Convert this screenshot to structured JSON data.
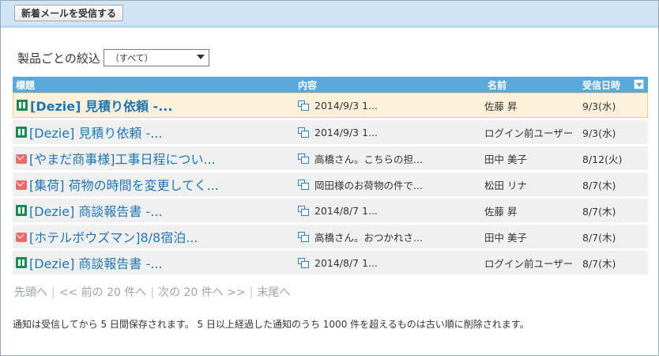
{
  "toolbar": {
    "fetch_label": "新着メールを受信する"
  },
  "filter": {
    "label": "製品ごとの絞込",
    "selected": "（すべて）"
  },
  "table": {
    "headers": {
      "subject": "標題",
      "content": "内容",
      "sender": "名前",
      "date": "受信日時"
    },
    "rows": [
      {
        "icon": "dezie-icon",
        "subject": "[Dezie] 見積り依頼 -...",
        "content": "2014/9/3 1...",
        "sender": "佐藤 昇",
        "date": "9/3(水)",
        "unread": true
      },
      {
        "icon": "dezie-icon",
        "subject": "[Dezie] 見積り依頼 -...",
        "content": "2014/9/3 1...",
        "sender": "ログイン前ユーザー",
        "date": "9/3(水)",
        "unread": false
      },
      {
        "icon": "mail-icon",
        "subject": "[やまだ商事様]工事日程につい...",
        "content": "高橋さん。こちらの担...",
        "sender": "田中 美子",
        "date": "8/12(火)",
        "unread": false
      },
      {
        "icon": "mail-icon",
        "subject": "[集荷] 荷物の時間を変更してく...",
        "content": "岡田様のお荷物の件で...",
        "sender": "松田 リナ",
        "date": "8/7(木)",
        "unread": false
      },
      {
        "icon": "dezie-icon",
        "subject": "[Dezie] 商談報告書 -...",
        "content": "2014/8/7 1...",
        "sender": "佐藤 昇",
        "date": "8/7(木)",
        "unread": false
      },
      {
        "icon": "mail-icon",
        "subject": "[ホテルボウズマン]8/8宿泊...",
        "content": "高橋さん。おつかれさ...",
        "sender": "田中 美子",
        "date": "8/7(木)",
        "unread": false
      },
      {
        "icon": "dezie-icon",
        "subject": "[Dezie] 商談報告書 -...",
        "content": "2014/8/7 1...",
        "sender": "ログイン前ユーザー",
        "date": "8/7(木)",
        "unread": false
      }
    ]
  },
  "pager": {
    "first": "先頭へ",
    "prev": "<< 前の 20 件へ",
    "next": "次の 20 件へ >>",
    "last": "末尾へ",
    "separator": "|"
  },
  "note": "通知は受信してから 5 日間保存されます。 5 日以上経過した通知のうち 1000 件を超えるものは古い順に削除されます。",
  "colors": {
    "header_bg": "#5ba9da",
    "topbar_bg": "#cfe4f5",
    "link": "#1f76b3",
    "unread_bg": "#fdf1db",
    "dezie": "#1a8a55",
    "mail": "#e46c6c"
  }
}
